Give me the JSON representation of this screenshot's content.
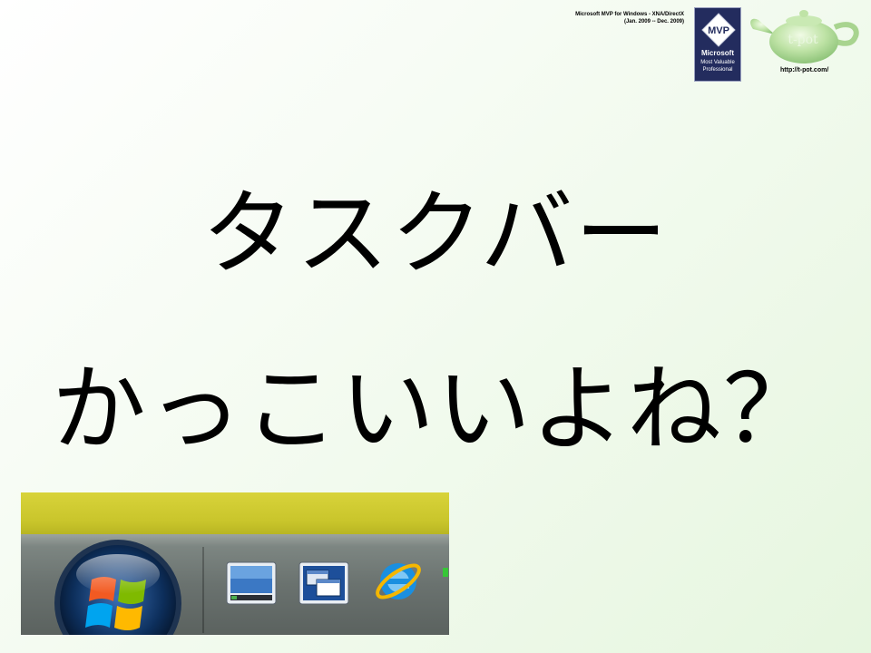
{
  "header": {
    "mvp_line1": "Microsoft MVP for Windows - XNA/DirectX",
    "mvp_line2": "(Jan. 2009 -- Dec. 2009)",
    "badge_mvp": "MVP",
    "badge_microsoft": "Microsoft",
    "badge_sub1": "Most Valuable",
    "badge_sub2": "Professional",
    "teapot_label": "t-pot",
    "url": "http://t-pot.com/"
  },
  "slide": {
    "line1": "タスクバー",
    "line2": "かっこいいよね？"
  },
  "screenshot": {
    "icons": [
      "windows-orb-icon",
      "show-desktop-icon",
      "switch-windows-icon",
      "internet-explorer-icon"
    ]
  },
  "colors": {
    "taskbar_yellow": "#d8d33a",
    "taskbar_gray": "#6a726f",
    "badge_navy": "#232c5e"
  }
}
